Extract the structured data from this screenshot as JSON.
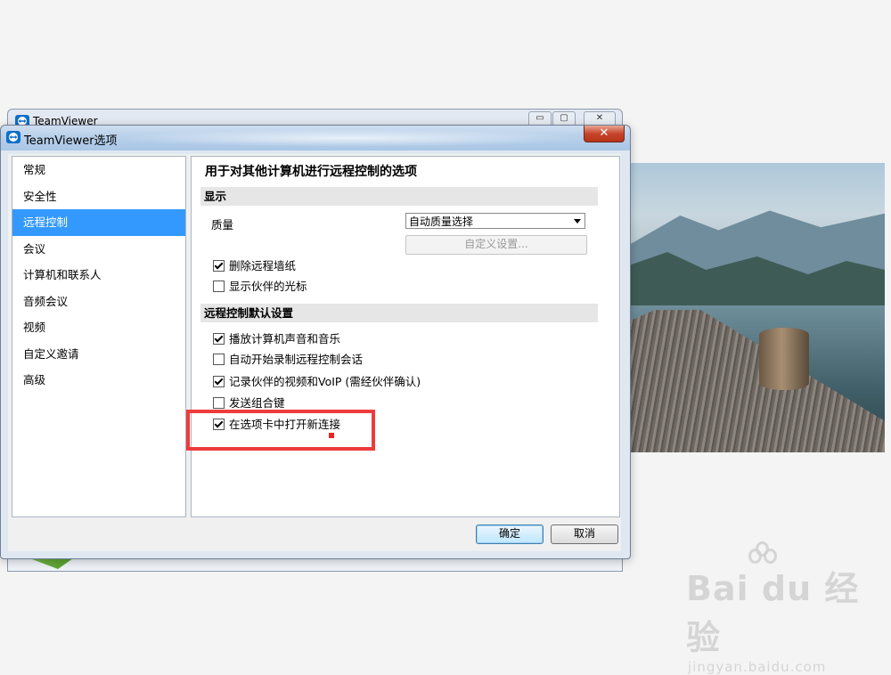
{
  "main_window": {
    "title": "TeamViewer",
    "controls": [
      "▭",
      "▢",
      "✕"
    ]
  },
  "dialog": {
    "title": "TeamViewer选项",
    "close_label": "✕",
    "nav_items": [
      {
        "label": "常规",
        "selected": false
      },
      {
        "label": "安全性",
        "selected": false
      },
      {
        "label": "远程控制",
        "selected": true
      },
      {
        "label": "会议",
        "selected": false
      },
      {
        "label": "计算机和联系人",
        "selected": false
      },
      {
        "label": "音频会议",
        "selected": false
      },
      {
        "label": "视频",
        "selected": false
      },
      {
        "label": "自定义邀请",
        "selected": false
      },
      {
        "label": "高级",
        "selected": false
      }
    ],
    "panel": {
      "heading": "用于对其他计算机进行远程控制的选项",
      "display_section": "显示",
      "quality_label": "质量",
      "quality_value": "自动质量选择",
      "custom_settings_button": "自定义设置...",
      "display_options": [
        {
          "label": "删除远程墙纸",
          "checked": true
        },
        {
          "label": "显示伙伴的光标",
          "checked": false
        }
      ],
      "defaults_section": "远程控制默认设置",
      "default_options": [
        {
          "label": "播放计算机声音和音乐",
          "checked": true
        },
        {
          "label": "自动开始录制远程控制会话",
          "checked": false
        },
        {
          "label": "记录伙伴的视频和VoIP (需经伙伴确认)",
          "checked": true
        },
        {
          "label": "发送组合键",
          "checked": false
        },
        {
          "label": "在选项卡中打开新连接",
          "checked": true
        }
      ]
    },
    "ok_button": "确定",
    "cancel_button": "取消"
  },
  "watermark": {
    "logo": "Bai du 经验",
    "url": "jingyan.baidu.com"
  },
  "colors": {
    "selection": "#3399ff",
    "highlight_box": "#ee3b3b"
  }
}
